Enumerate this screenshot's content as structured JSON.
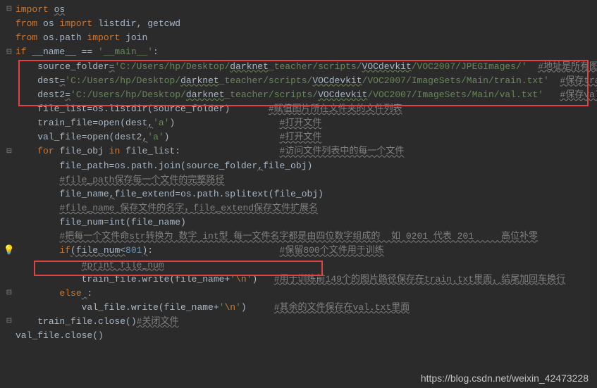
{
  "code": {
    "l1": {
      "import": "import ",
      "os": "os"
    },
    "l2": {
      "from": "from ",
      "os": "os ",
      "import": "import ",
      "rest": "listdir, getcwd"
    },
    "l3": {
      "from": "from ",
      "osp": "os.path ",
      "import": "import ",
      "join": "join"
    },
    "l4": {
      "if": "if ",
      "name": "__name__ ",
      "eq": "== ",
      "main": "'__main__'",
      "colon": ":"
    },
    "l5": {
      "indent": "    ",
      "var": "source_folder",
      "eq": "=",
      "q1": "'",
      "p1": "C:/Users/hp/Desktop/",
      "p2": "darknet",
      "p3": "_teacher/scripts/",
      "p4": "VOCdevkit",
      "p5": "/VOC2007/JPEGImages/'",
      "sp": "  ",
      "cmt": "#地址是所有图片的保存地点"
    },
    "l6": {
      "indent": "    ",
      "var": "dest",
      "eq": "=",
      "q1": "'",
      "p1": "C:/Users/hp/Desktop/",
      "p2": "darknet",
      "p3": "_teacher/scripts/",
      "p4": "VOCdevkit",
      "p5": "/VOC2007/ImageSets/Main/train.txt'",
      "sp": "  ",
      "cmt": "#保存train.txt的地址"
    },
    "l7": {
      "indent": "    ",
      "var": "dest2",
      "eq": "=",
      "q1": "'",
      "p1": "C:/Users/hp/Desktop/",
      "p2": "darknet",
      "p3": "_teacher/scripts/",
      "p4": "VOCdevkit",
      "p5": "/VOC2007/ImageSets/Main/val.txt'",
      "sp": "   ",
      "cmt": "#保存val.txt的地址"
    },
    "l8": {
      "indent": "    ",
      "code": "file_list=os.listdir(source_folder)",
      "sp": "       ",
      "cmt": "#赋值图片所在文件夹的文件列表"
    },
    "l9": {
      "indent": "    ",
      "code": "train_file=open(dest",
      "comma": ",",
      "str": "'a'",
      "end": ")",
      "sp": "                   ",
      "cmt": "#打开文件"
    },
    "l10": {
      "indent": "    ",
      "code": "val_file=open(dest2",
      "comma": ",",
      "str": "'a'",
      "end": ")",
      "sp": "                    ",
      "cmt": "#打开文件"
    },
    "l11": {
      "indent": "    ",
      "for": "for ",
      "v": "file_obj ",
      "in": "in ",
      "lst": "file_list:",
      "sp": "                  ",
      "cmt": "#访问文件列表中的每一个文件"
    },
    "l12": {
      "indent": "        ",
      "code": "file_path=os.path.join(source_folder",
      "comma": ",",
      "rest": "file_obj)"
    },
    "l13": {
      "indent": "        ",
      "cmt": "#file_path保存每一个文件的完整路径"
    },
    "l14": {
      "indent": "        ",
      "code": "file_name",
      "comma": ",",
      "rest": "file_extend=os.path.splitext(file_obj)"
    },
    "l15": {
      "indent": "        ",
      "cmt": "#file_name 保存文件的名字，file_extend保存文件扩展名"
    },
    "l16": {
      "indent": "        ",
      "code": "file_num=int(file_name)"
    },
    "l17": {
      "indent": "        ",
      "cmt": "#把每一个文件命str转换为 数字 int型 每一文件名字都是由四位数字组成的  如 0201 代表 201     高位补零"
    },
    "l18": {
      "indent": "        ",
      "if": "if",
      "paren": "(file_num<",
      "num": "801",
      "close": ")",
      "colon": ":",
      "sp": "                       ",
      "cmt": "#保留800个文件用于训练"
    },
    "l19": {
      "indent": "            ",
      "cmt": "#print file_num"
    },
    "l20": {
      "indent": "            ",
      "code": "train_file.write(file_name+",
      "str": "'\\n'",
      "end": ")",
      "sp": "   ",
      "cmt": "#用于训练前149个的图片路径保存在train.txt里面，结尾加回车换行"
    },
    "l21": {
      "indent": "        ",
      "else": "else",
      "sp": " ",
      "colon": ":"
    },
    "l22": {
      "indent": "            ",
      "code": "val_file.write(file_name+",
      "str": "'\\n'",
      "end": ")",
      "sp": "     ",
      "cmt": "#其余的文件保存在val.txt里面"
    },
    "l23": {
      "indent": "    ",
      "code": "train_file.close()",
      "cmt": "#关闭文件"
    },
    "l24": {
      "indent": "",
      "code": "val_file.close()"
    }
  },
  "watermark": "https://blog.csdn.net/weixin_42473228"
}
